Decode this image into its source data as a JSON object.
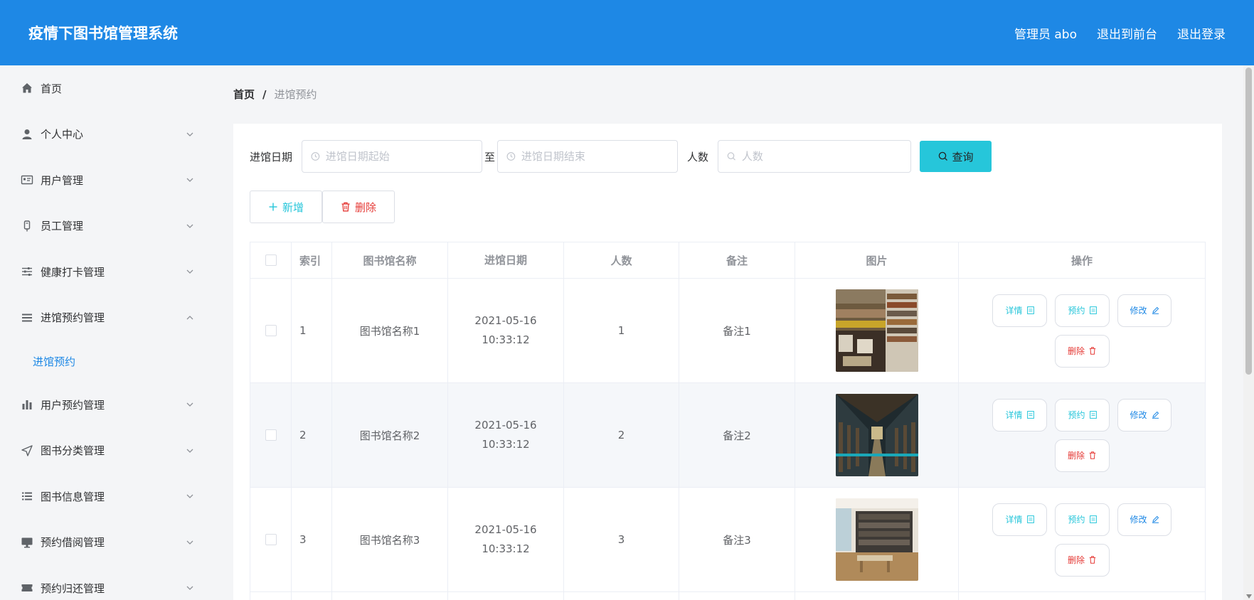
{
  "header": {
    "title": "疫情下图书馆管理系统",
    "admin": "管理员 abo",
    "to_front": "退出到前台",
    "logout": "退出登录"
  },
  "sidebar": {
    "items": [
      {
        "label": "首页",
        "icon": "home-icon"
      },
      {
        "label": "个人中心",
        "icon": "user-icon"
      },
      {
        "label": "用户管理",
        "icon": "id-card-icon"
      },
      {
        "label": "员工管理",
        "icon": "badge-icon"
      },
      {
        "label": "健康打卡管理",
        "icon": "sliders-icon"
      },
      {
        "label": "进馆预约管理",
        "icon": "list-icon"
      },
      {
        "label": "进馆预约"
      },
      {
        "label": "用户预约管理",
        "icon": "bar-chart-icon"
      },
      {
        "label": "图书分类管理",
        "icon": "navigation-icon"
      },
      {
        "label": "图书信息管理",
        "icon": "list-icon"
      },
      {
        "label": "预约借阅管理",
        "icon": "monitor-icon"
      },
      {
        "label": "预约归还管理",
        "icon": "ticket-icon"
      }
    ]
  },
  "breadcrumb": {
    "home": "首页",
    "sep": "/",
    "current": "进馆预约"
  },
  "search": {
    "date_label": "进馆日期",
    "date_start_placeholder": "进馆日期起始",
    "to": "至",
    "date_end_placeholder": "进馆日期结束",
    "count_label": "人数",
    "count_placeholder": "人数",
    "query": "查询"
  },
  "actions": {
    "add": "新增",
    "delete": "删除"
  },
  "table": {
    "columns": [
      "索引",
      "图书馆名称",
      "进馆日期",
      "人数",
      "备注",
      "图片",
      "操作"
    ],
    "rows": [
      {
        "index": "1",
        "name": "图书馆名称1",
        "date": "2021-05-16 10:33:12",
        "count": "1",
        "note": "备注1"
      },
      {
        "index": "2",
        "name": "图书馆名称2",
        "date": "2021-05-16 10:33:12",
        "count": "2",
        "note": "备注2"
      },
      {
        "index": "3",
        "name": "图书馆名称3",
        "date": "2021-05-16 10:33:12",
        "count": "3",
        "note": "备注3"
      }
    ],
    "op": {
      "detail": "详情",
      "reserve": "预约",
      "edit": "修改",
      "delete": "删除"
    }
  },
  "colors": {
    "primary": "#1e88e5",
    "accent": "#26c6da",
    "danger": "#e53935"
  }
}
